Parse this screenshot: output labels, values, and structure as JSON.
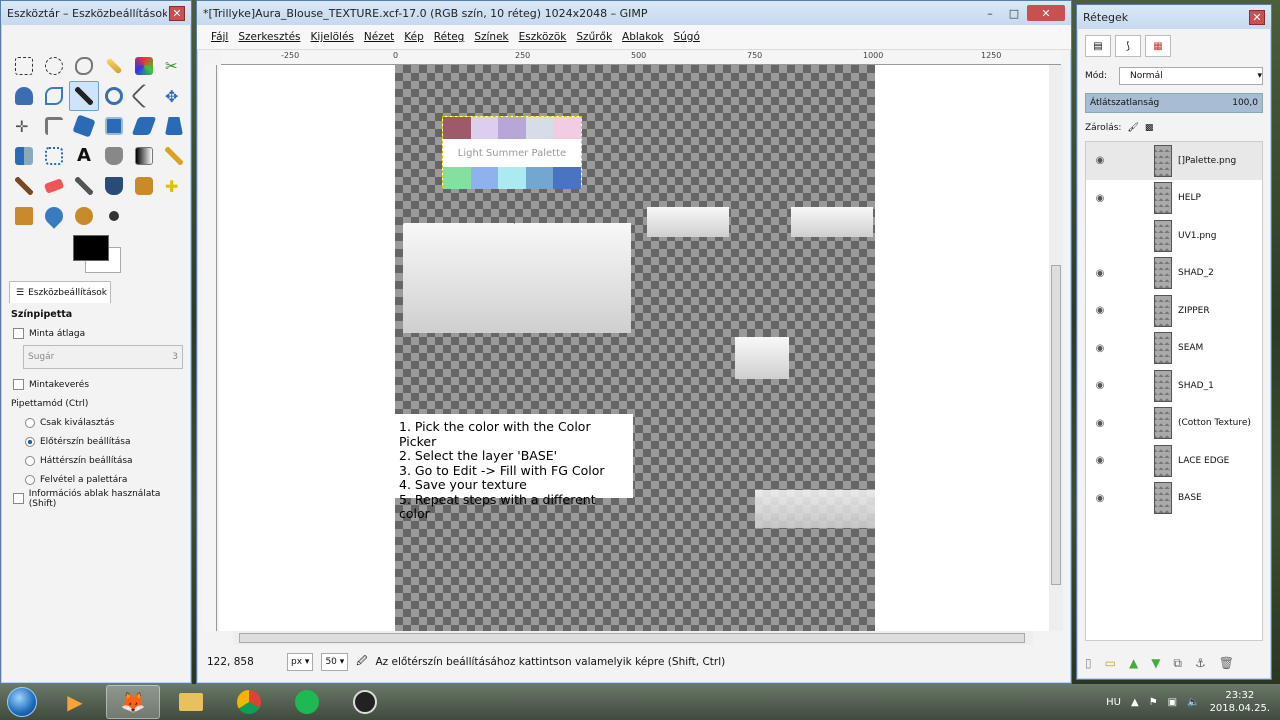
{
  "toolbox": {
    "title": "Eszköztár – Eszközbeállítások",
    "options_tab": "Eszközbeállítások",
    "tool_name": "Színpipetta",
    "sample_average": "Minta átlaga",
    "radius_label": "Sugár",
    "radius_value": "3",
    "sample_merged": "Mintakeverés",
    "pick_mode": "Pipettamód  (Ctrl)",
    "mode_options": [
      "Csak kiválasztás",
      "Előtérszín beállítása",
      "Háttérszín beállítása",
      "Felvétel a palettára"
    ],
    "info_window": "Információs ablak használata  (Shift)"
  },
  "image_window": {
    "title": "*[Trillyke]Aura_Blouse_TEXTURE.xcf-17.0 (RGB szín, 10 réteg) 1024x2048 – GIMP",
    "menu": [
      "Fájl",
      "Szerkesztés",
      "Kijelölés",
      "Nézet",
      "Kép",
      "Réteg",
      "Színek",
      "Eszközök",
      "Szűrők",
      "Ablakok",
      "Súgó"
    ],
    "ruler_labels": [
      "-250",
      "0",
      "250",
      "500",
      "750",
      "1000",
      "1250"
    ],
    "palette_title": "Light Summer Palette",
    "palette_row1": [
      "#9e5a6a",
      "#dccfee",
      "#b8a6d8",
      "#d6dde8",
      "#f2cce0"
    ],
    "palette_row2": [
      "#84e0a0",
      "#8eb2ee",
      "#aaeaf0",
      "#74a6d2",
      "#4a74c2"
    ],
    "instructions": [
      "1. Pick the color with the Color Picker",
      "2. Select the layer 'BASE'",
      "3. Go to Edit -> Fill with FG Color",
      "4. Save your texture",
      "5. Repeat steps with a different color"
    ],
    "status": {
      "coords": "122, 858",
      "unit": "px",
      "zoom": "50",
      "message": "Az előtérszín beállításához kattintson valamelyik képre (Shift, Ctrl)"
    }
  },
  "layers_panel": {
    "title": "Rétegek",
    "mode_label": "Mód:",
    "mode_value": "Normál",
    "opacity_label": "Átlátszatlanság",
    "opacity_value": "100,0",
    "lock_label": "Zárolás:",
    "layers": [
      {
        "name": "[]Palette.png",
        "visible": true
      },
      {
        "name": "HELP",
        "visible": true
      },
      {
        "name": "UV1.png",
        "visible": false
      },
      {
        "name": "SHAD_2",
        "visible": true
      },
      {
        "name": "ZIPPER",
        "visible": true
      },
      {
        "name": "SEAM",
        "visible": true
      },
      {
        "name": "SHAD_1",
        "visible": true
      },
      {
        "name": "(Cotton Texture)",
        "visible": true
      },
      {
        "name": "LACE EDGE",
        "visible": true
      },
      {
        "name": "BASE",
        "visible": true
      }
    ]
  },
  "taskbar": {
    "lang": "HU",
    "time": "23:32",
    "date": "2018.04.25."
  }
}
